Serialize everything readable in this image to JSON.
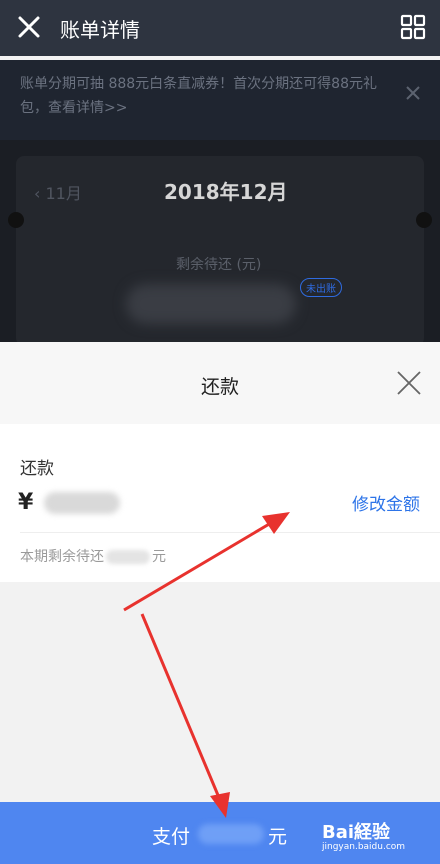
{
  "header": {
    "title": "账单详情"
  },
  "promo": {
    "text": "账单分期可抽 888元白条直减券！首次分期还可得88元礼包，查看详情>>"
  },
  "bill_card": {
    "prev_month": "11月",
    "current_month": "2018年12月",
    "remaining_label": "剩余待还 (元)",
    "badge": "未出账"
  },
  "repay_sheet": {
    "title": "还款",
    "amount_label": "还款",
    "currency": "¥",
    "edit_amount": "修改金额",
    "remaining_prefix": "本期剩余待还",
    "remaining_suffix": "元",
    "pay_prefix": "支付",
    "pay_suffix": "元"
  },
  "watermark": {
    "brand": "Bai経验",
    "url": "jingyan.baidu.com"
  },
  "colors": {
    "accent": "#4f86f0",
    "link": "#2d74e8",
    "annotation": "#e8322e"
  }
}
